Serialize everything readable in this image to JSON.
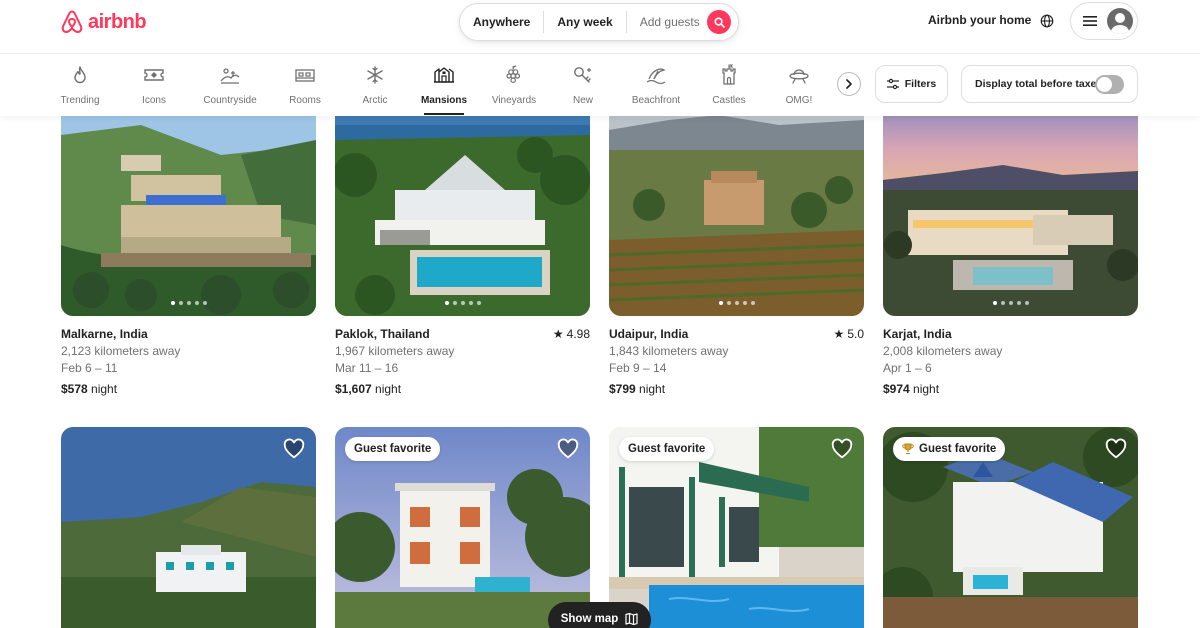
{
  "brand": {
    "name": "airbnb",
    "color": "#ff385c"
  },
  "search": {
    "location": "Anywhere",
    "dates": "Any week",
    "guests": "Add guests"
  },
  "header": {
    "host_link": "Airbnb your home"
  },
  "categories": [
    {
      "label": "Trending",
      "icon": "flame-icon"
    },
    {
      "label": "Icons",
      "icon": "ticket-icon"
    },
    {
      "label": "Countryside",
      "icon": "countryside-icon"
    },
    {
      "label": "Rooms",
      "icon": "rooms-icon"
    },
    {
      "label": "Arctic",
      "icon": "snowflake-icon"
    },
    {
      "label": "Mansions",
      "icon": "mansion-icon",
      "active": true
    },
    {
      "label": "Vineyards",
      "icon": "grapes-icon"
    },
    {
      "label": "New",
      "icon": "key-icon"
    },
    {
      "label": "Beachfront",
      "icon": "beach-icon"
    },
    {
      "label": "Castles",
      "icon": "castle-icon"
    },
    {
      "label": "OMG!",
      "icon": "ufo-icon"
    }
  ],
  "filters": {
    "label": "Filters",
    "tax_toggle_label": "Display total before taxes",
    "tax_toggle_on": false
  },
  "listings": [
    {
      "title": "Malkarne, India",
      "distance": "2,123 kilometers away",
      "dates": "Feb 6 – 11",
      "price": "$578",
      "price_unit": "night",
      "rating": ""
    },
    {
      "title": "Paklok, Thailand",
      "distance": "1,967 kilometers away",
      "dates": "Mar 11 – 16",
      "price": "$1,607",
      "price_unit": "night",
      "rating": "4.98"
    },
    {
      "title": "Udaipur, India",
      "distance": "1,843 kilometers away",
      "dates": "Feb 9 – 14",
      "price": "$799",
      "price_unit": "night",
      "rating": "5.0"
    },
    {
      "title": "Karjat, India",
      "distance": "2,008 kilometers away",
      "dates": "Apr 1 – 6",
      "price": "$974",
      "price_unit": "night",
      "rating": ""
    }
  ],
  "listings_row2": [
    {
      "badge": ""
    },
    {
      "badge": "Guest favorite"
    },
    {
      "badge": "Guest favorite"
    },
    {
      "badge": "Guest favorite",
      "badge_icon": "trophy-icon"
    }
  ],
  "show_map": "Show map"
}
